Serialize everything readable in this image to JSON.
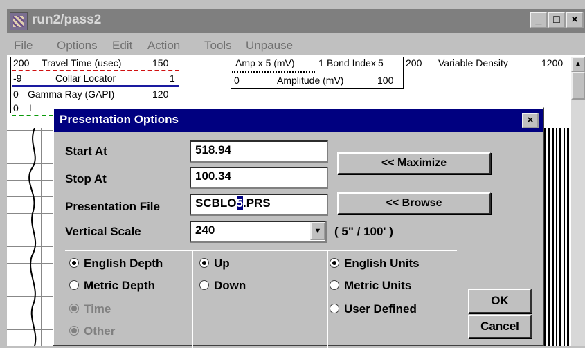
{
  "window": {
    "title": "run2/pass2",
    "controls": {
      "minimize": "_",
      "maximize": "□",
      "close": "×"
    }
  },
  "menu": [
    "File",
    "Options",
    "Edit",
    "Action",
    "Tools",
    "Unpause"
  ],
  "track_headers": {
    "travel_time": {
      "left": "200",
      "label": "Travel Time (usec)",
      "right": "150"
    },
    "collar_locator": {
      "left": "-9",
      "label": "Collar Locator",
      "right": "1"
    },
    "gamma_ray": {
      "left": "0",
      "label": "Gamma Ray (GAPI)",
      "right": "120"
    },
    "fourth_left": "0",
    "fourth_label_stub": "L",
    "amp_x5": "Amp x 5 (mV)",
    "bond_index": {
      "left": "1",
      "label": "Bond Index",
      "right": "5"
    },
    "vd_left": "200",
    "variable_density": {
      "label": "Variable Density",
      "right": "1200"
    },
    "amplitude": {
      "left": "0",
      "label": "Amplitude (mV)",
      "right": "100"
    }
  },
  "dialog": {
    "title": "Presentation Options",
    "close_glyph": "×",
    "start_at": {
      "label": "Start At",
      "value": "518.94"
    },
    "stop_at": {
      "label": "Stop At",
      "value": "100.34"
    },
    "presentation_file": {
      "label": "Presentation File",
      "value_before_caret": "SCBLO",
      "caret_char": "5",
      "value_after_caret": ".PRS"
    },
    "vertical_scale": {
      "label": "Vertical Scale",
      "value": "240",
      "note": "( 5\" / 100' )"
    },
    "buttons": {
      "maximize": "<< Maximize",
      "browse": "<< Browse",
      "ok": "OK",
      "cancel": "Cancel"
    },
    "depth_options": [
      {
        "label": "English Depth",
        "selected": true,
        "disabled": false
      },
      {
        "label": "Metric Depth",
        "selected": false,
        "disabled": false
      },
      {
        "label": "Time",
        "selected": true,
        "disabled": true
      },
      {
        "label": "Other",
        "selected": true,
        "disabled": true
      }
    ],
    "direction_options": [
      {
        "label": "Up",
        "selected": true
      },
      {
        "label": "Down",
        "selected": false
      }
    ],
    "unit_options": [
      {
        "label": "English Units",
        "selected": true
      },
      {
        "label": "Metric Units",
        "selected": false
      },
      {
        "label": "User Defined",
        "selected": false
      }
    ]
  },
  "colors": {
    "title_active": "#000080",
    "title_inactive": "#7f7f7f",
    "face": "#c0c0c0",
    "travel_line": "#d01010",
    "collar_line": "#1a1aa0",
    "gamma_line": "#0a9a0a"
  }
}
